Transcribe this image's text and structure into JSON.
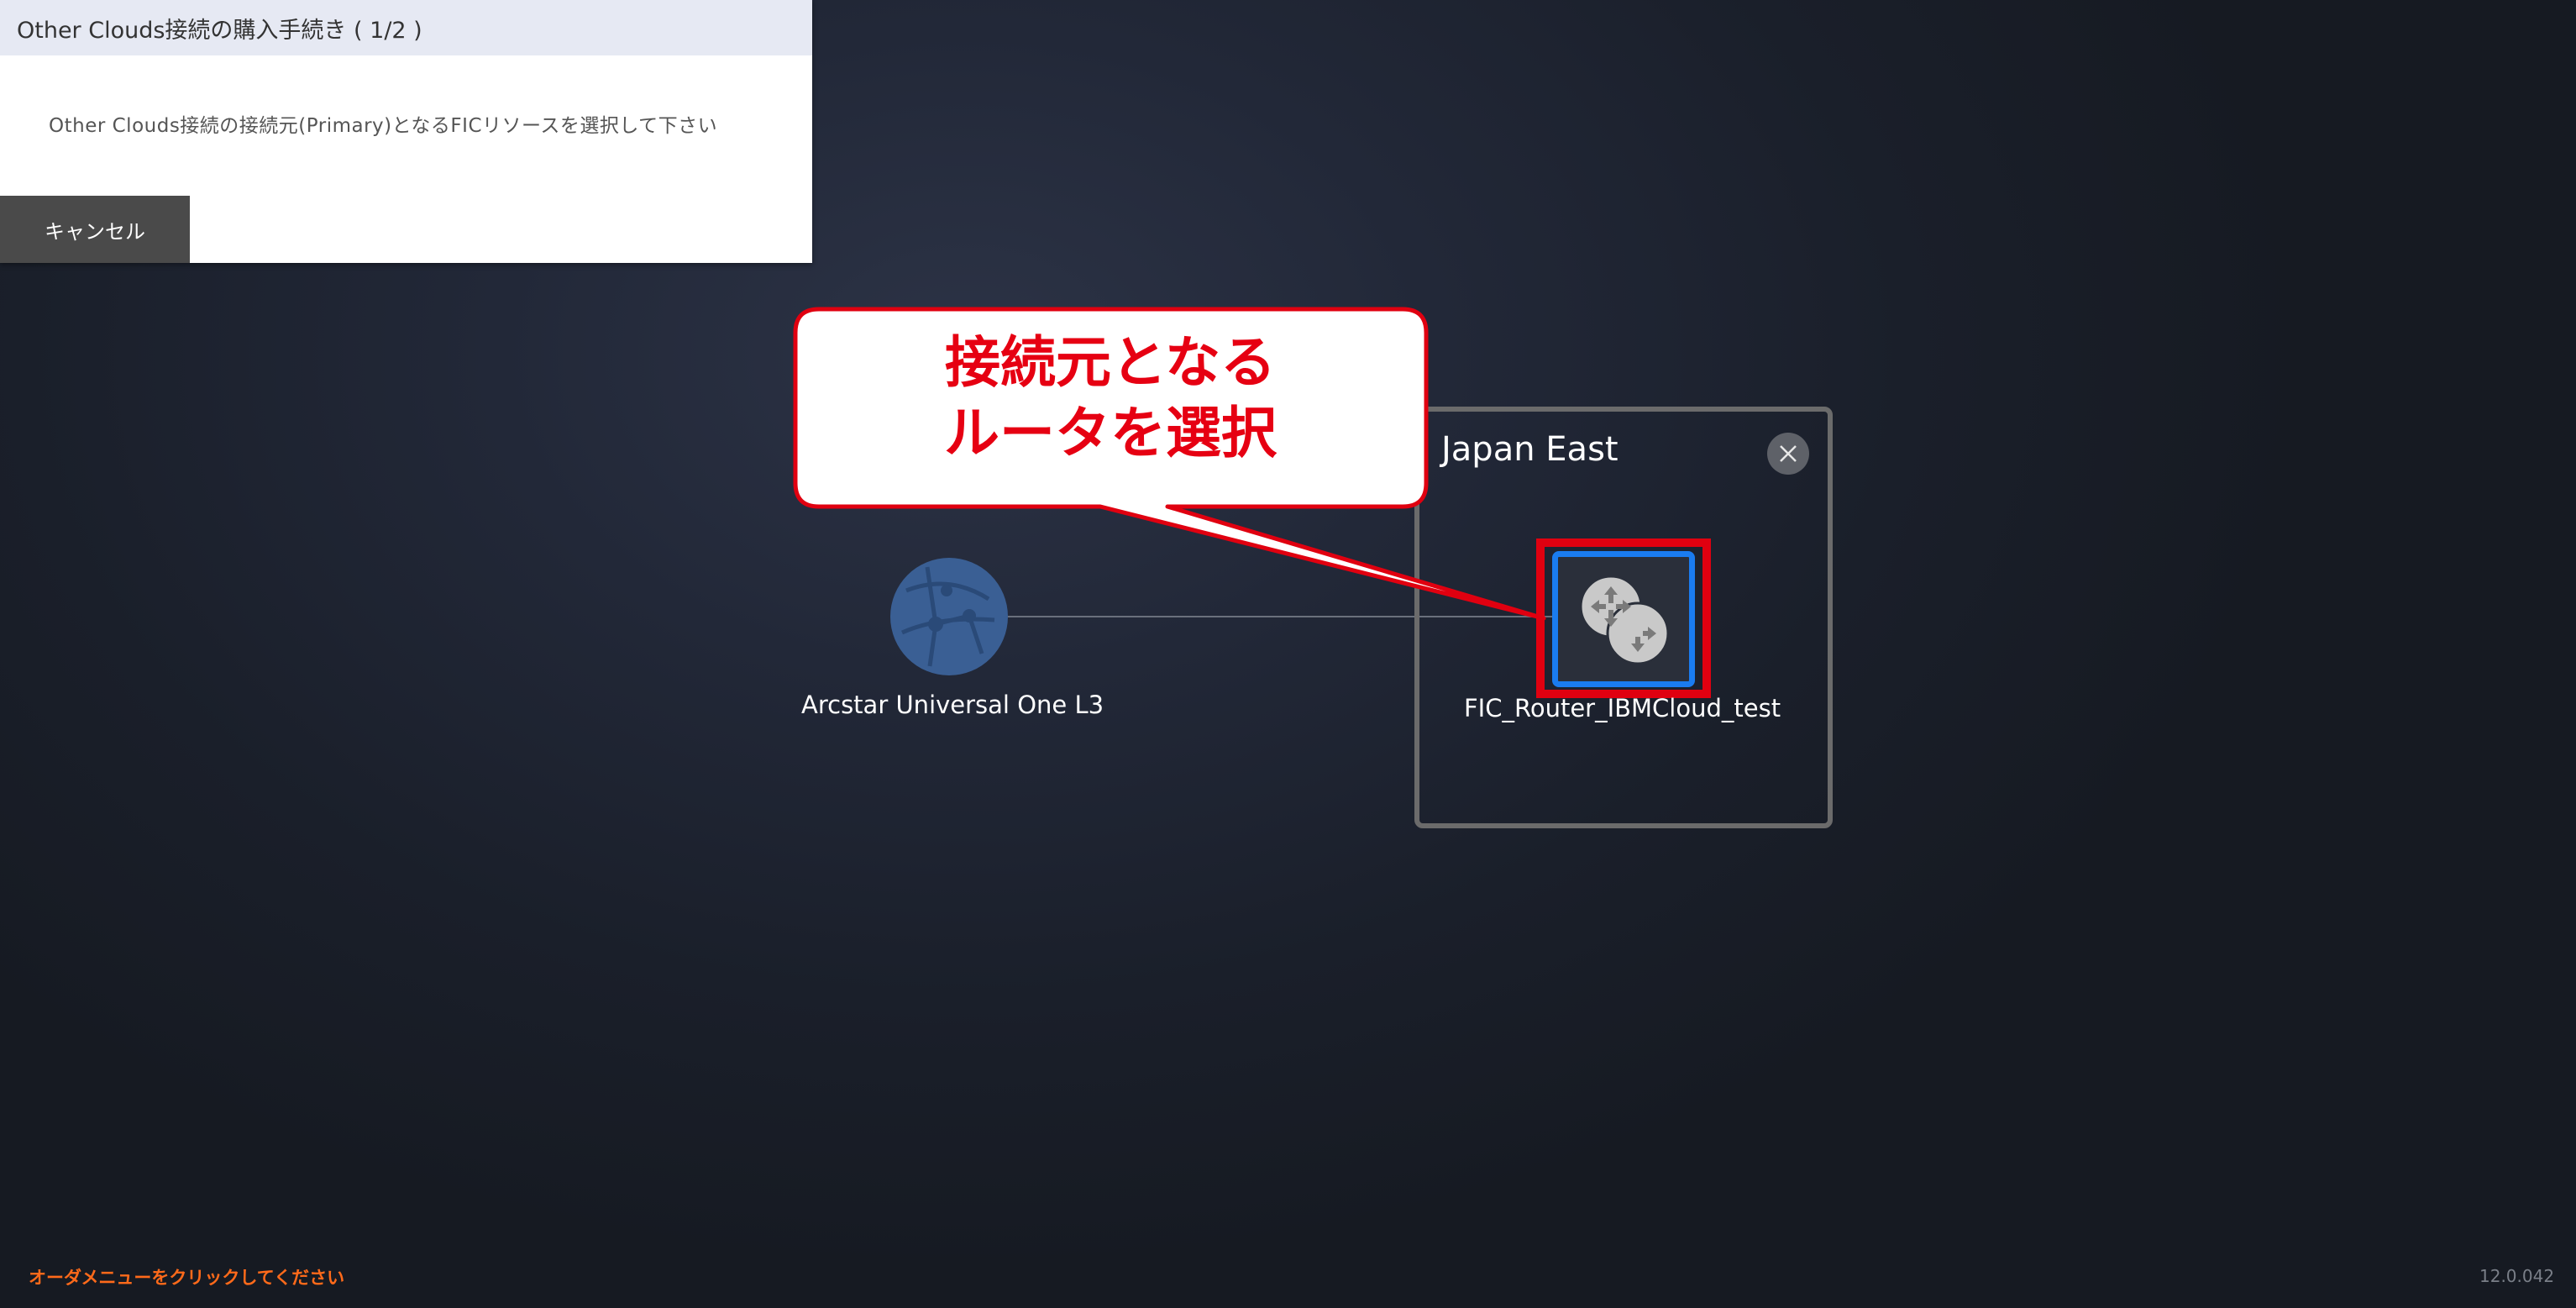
{
  "dialog": {
    "title": "Other Clouds接続の購入手続き ( 1/2 )",
    "message": "Other Clouds接続の接続元(Primary)となるFICリソースを選択して下さい",
    "cancel_label": "キャンセル"
  },
  "canvas": {
    "globe_node_label": "Arcstar Universal One L3",
    "region": {
      "title": "Japan East",
      "close_icon": "close-icon"
    },
    "router_node_label": "FIC_Router_IBMCloud_test",
    "router_icon": "router-icon",
    "globe_icon": "network-globe-icon"
  },
  "annotation": {
    "line1": "接続元となる",
    "line2": "ルータを選択"
  },
  "footer": {
    "hint": "オーダメニューをクリックしてください",
    "version": "12.0.042"
  },
  "colors": {
    "accent_blue": "#1a7cf0",
    "highlight_red": "#e00010",
    "hint_orange": "#ff6a1a"
  }
}
